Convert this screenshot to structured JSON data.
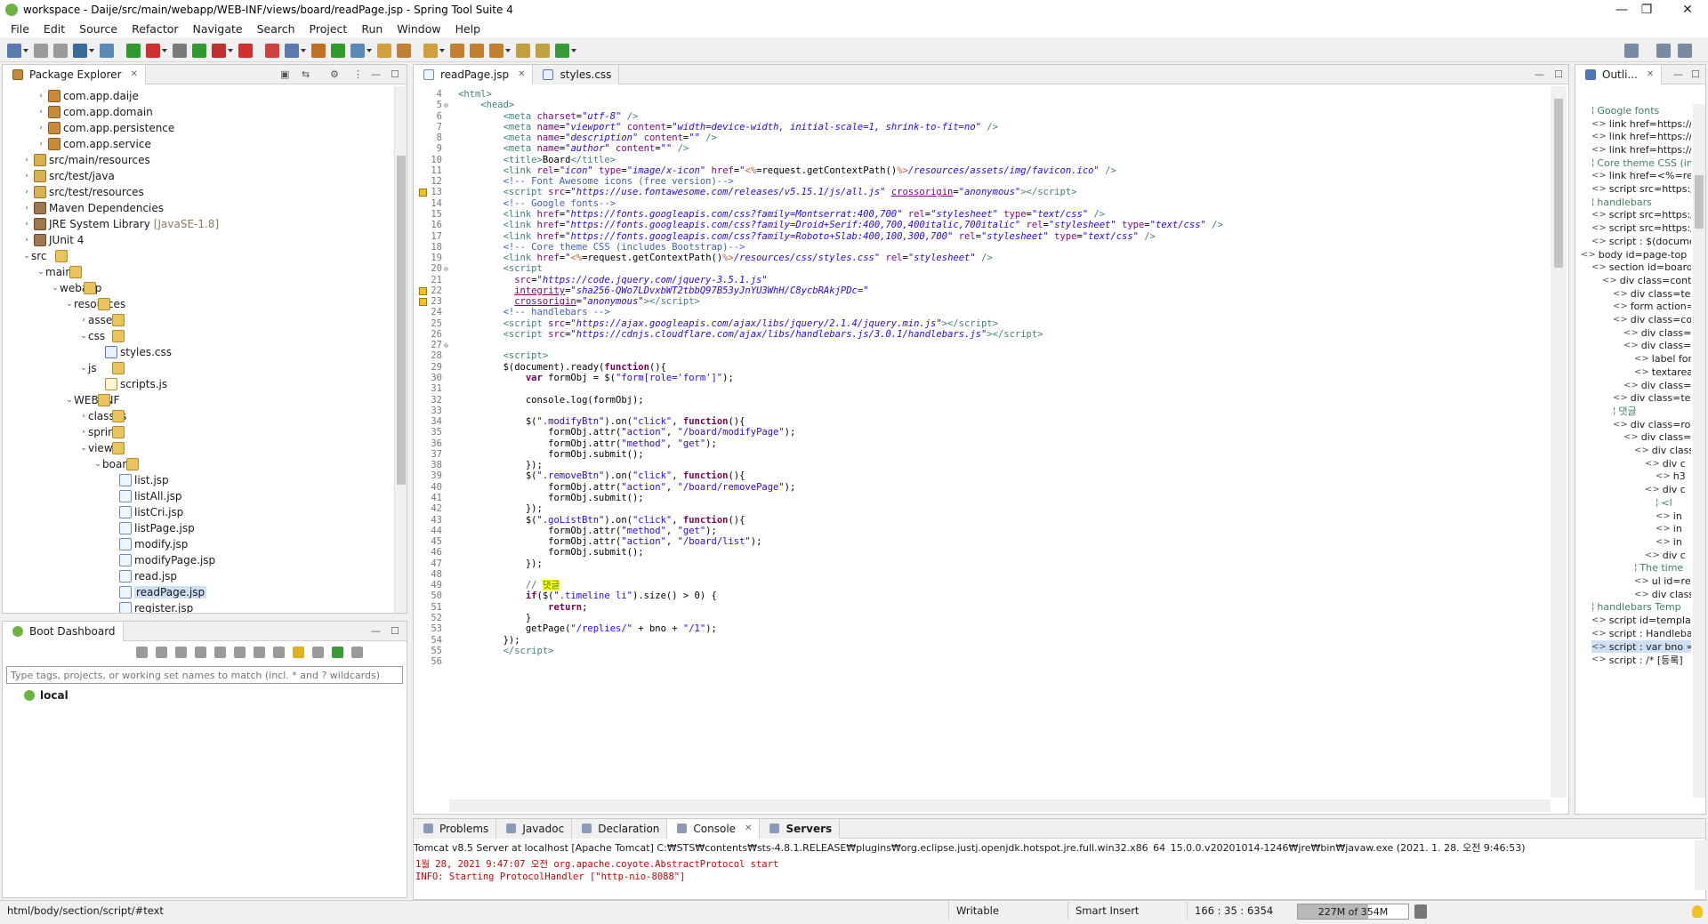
{
  "window": {
    "title": "workspace - Daije/src/main/webapp/WEB-INF/views/board/readPage.jsp - Spring Tool Suite 4",
    "controls": [
      "minimize",
      "restore",
      "close"
    ]
  },
  "menu": [
    "File",
    "Edit",
    "Source",
    "Refactor",
    "Navigate",
    "Search",
    "Project",
    "Run",
    "Window",
    "Help"
  ],
  "package_explorer": {
    "tab_label": "Package Explorer",
    "items": [
      {
        "label": "com.app.daije",
        "level": 2,
        "icon": "package-icon"
      },
      {
        "label": "com.app.domain",
        "level": 2,
        "icon": "package-icon"
      },
      {
        "label": "com.app.persistence",
        "level": 2,
        "icon": "package-icon"
      },
      {
        "label": "com.app.service",
        "level": 2,
        "icon": "package-icon"
      },
      {
        "label": "src/main/resources",
        "level": 1,
        "icon": "source-folder-icon"
      },
      {
        "label": "src/test/java",
        "level": 1,
        "icon": "source-folder-icon"
      },
      {
        "label": "src/test/resources",
        "level": 1,
        "icon": "source-folder-icon"
      },
      {
        "label": "Maven Dependencies",
        "level": 1,
        "icon": "library-icon"
      },
      {
        "label": "JRE System Library",
        "suffix": "[JavaSE-1.8]",
        "level": 1,
        "icon": "library-icon"
      },
      {
        "label": "JUnit 4",
        "level": 1,
        "icon": "library-icon"
      },
      {
        "label": "src",
        "level": 1,
        "icon": "folder-icon",
        "open": true
      },
      {
        "label": "main",
        "level": 2,
        "icon": "folder-icon",
        "open": true
      },
      {
        "label": "webapp",
        "level": 3,
        "icon": "folder-icon",
        "open": true
      },
      {
        "label": "resources",
        "level": 4,
        "icon": "folder-icon",
        "open": true
      },
      {
        "label": "assets",
        "level": 5,
        "icon": "folder-icon"
      },
      {
        "label": "css",
        "level": 5,
        "icon": "folder-icon",
        "open": true
      },
      {
        "label": "styles.css",
        "level": 6,
        "icon": "css-file-icon"
      },
      {
        "label": "js",
        "level": 5,
        "icon": "folder-icon",
        "open": true
      },
      {
        "label": "scripts.js",
        "level": 6,
        "icon": "js-file-icon"
      },
      {
        "label": "WEB-INF",
        "level": 4,
        "icon": "folder-icon",
        "open": true
      },
      {
        "label": "classes",
        "level": 5,
        "icon": "folder-icon"
      },
      {
        "label": "spring",
        "level": 5,
        "icon": "folder-icon"
      },
      {
        "label": "views",
        "level": 5,
        "icon": "folder-icon",
        "open": true
      },
      {
        "label": "board",
        "level": 6,
        "icon": "folder-icon",
        "open": true
      },
      {
        "label": "list.jsp",
        "level": 7,
        "icon": "jsp-file-icon"
      },
      {
        "label": "listAll.jsp",
        "level": 7,
        "icon": "jsp-file-icon"
      },
      {
        "label": "listCri.jsp",
        "level": 7,
        "icon": "jsp-file-icon"
      },
      {
        "label": "listPage.jsp",
        "level": 7,
        "icon": "jsp-file-icon"
      },
      {
        "label": "modify.jsp",
        "level": 7,
        "icon": "jsp-file-icon"
      },
      {
        "label": "modifyPage.jsp",
        "level": 7,
        "icon": "jsp-file-icon"
      },
      {
        "label": "read.jsp",
        "level": 7,
        "icon": "jsp-file-icon"
      },
      {
        "label": "readPage.jsp",
        "level": 7,
        "icon": "jsp-file-icon",
        "selected": true
      },
      {
        "label": "register.jsp",
        "level": 7,
        "icon": "jsp-file-icon"
      }
    ]
  },
  "boot_dashboard": {
    "tab_label": "Boot Dashboard",
    "filter_placeholder": "Type tags, projects, or working set names to match (incl. * and ? wildcards)",
    "local_label": "local"
  },
  "editor": {
    "tabs": [
      {
        "label": "readPage.jsp",
        "active": true
      },
      {
        "label": "styles.css",
        "active": false
      }
    ],
    "lines": [
      {
        "n": "4",
        "html": "<span class='tag'>&lt;html&gt;</span>"
      },
      {
        "n": "5",
        "fold": true,
        "html": "    <span class='tag'>&lt;head&gt;</span>"
      },
      {
        "n": "6",
        "html": "        <span class='tag'>&lt;meta</span> <span class='att'>charset</span>=<span class='str'>\"utf-8\"</span> <span class='tag'>/&gt;</span>"
      },
      {
        "n": "7",
        "html": "        <span class='tag'>&lt;meta</span> <span class='att'>name</span>=<span class='str'>\"viewport\"</span> <span class='att'>content</span>=<span class='str'>\"width=device-width, initial-scale=1, shrink-to-fit=no\"</span> <span class='tag'>/&gt;</span>"
      },
      {
        "n": "8",
        "html": "        <span class='tag'>&lt;meta</span> <span class='att'>name</span>=<span class='str'>\"description\"</span> <span class='att'>content</span>=<span class='str'>\"\"</span> <span class='tag'>/&gt;</span>"
      },
      {
        "n": "9",
        "html": "        <span class='tag'>&lt;meta</span> <span class='att'>name</span>=<span class='str'>\"author\"</span> <span class='att'>content</span>=<span class='str'>\"\"</span> <span class='tag'>/&gt;</span>"
      },
      {
        "n": "10",
        "html": "        <span class='tag'>&lt;title&gt;</span>Board<span class='tag'>&lt;/title&gt;</span>"
      },
      {
        "n": "11",
        "html": "        <span class='tag'>&lt;link</span> <span class='att'>rel</span>=<span class='str'>\"icon\"</span> <span class='att'>type</span>=<span class='str'>\"image/x-icon\"</span> <span class='att'>href</span>=<span class='str'>\"</span><span style='color:#bf5f3f'>&lt;%</span>=request.getContextPath()<span style='color:#bf5f3f'>%&gt;</span><span class='str'>/resources/assets/img/favicon.ico\"</span> <span class='tag'>/&gt;</span>"
      },
      {
        "n": "12",
        "html": "        <span class='cmt'>&lt;!-- Font Awesome icons (free version)--&gt;</span>"
      },
      {
        "n": "13",
        "warn": true,
        "html": "        <span class='tag'>&lt;script</span> <span class='att'>src</span>=<span class='str'>\"https://use.fontawesome.com/releases/v5.15.1/js/all.js\"</span> <span class='att' style='text-decoration:underline'>crossorigin</span>=<span class='str'>\"anonymous\"</span><span class='tag'>&gt;&lt;/script&gt;</span>"
      },
      {
        "n": "14",
        "html": "        <span class='cmt'>&lt;!-- Google fonts--&gt;</span>"
      },
      {
        "n": "15",
        "html": "        <span class='tag'>&lt;link</span> <span class='att'>href</span>=<span class='str'>\"https://fonts.googleapis.com/css?family=Montserrat:400,700\"</span> <span class='att'>rel</span>=<span class='str'>\"stylesheet\"</span> <span class='att'>type</span>=<span class='str'>\"text/css\"</span> <span class='tag'>/&gt;</span>"
      },
      {
        "n": "16",
        "html": "        <span class='tag'>&lt;link</span> <span class='att'>href</span>=<span class='str'>\"https://fonts.googleapis.com/css?family=Droid+Serif:400,700,400italic,700italic\"</span> <span class='att'>rel</span>=<span class='str'>\"stylesheet\"</span> <span class='att'>type</span>=<span class='str'>\"text/css\"</span> <span class='tag'>/&gt;</span>"
      },
      {
        "n": "17",
        "html": "        <span class='tag'>&lt;link</span> <span class='att'>href</span>=<span class='str'>\"https://fonts.googleapis.com/css?family=Roboto+Slab:400,100,300,700\"</span> <span class='att'>rel</span>=<span class='str'>\"stylesheet\"</span> <span class='att'>type</span>=<span class='str'>\"text/css\"</span> <span class='tag'>/&gt;</span>"
      },
      {
        "n": "18",
        "html": "        <span class='cmt'>&lt;!-- Core theme CSS (includes Bootstrap)--&gt;</span>"
      },
      {
        "n": "19",
        "html": "        <span class='tag'>&lt;link</span> <span class='att'>href</span>=<span class='str'>\"</span><span style='color:#bf5f3f'>&lt;%</span>=request.getContextPath()<span style='color:#bf5f3f'>%&gt;</span><span class='str'>/resources/css/styles.css\"</span> <span class='att'>rel</span>=<span class='str'>\"stylesheet\"</span> <span class='tag'>/&gt;</span>"
      },
      {
        "n": "20",
        "fold": true,
        "html": "        <span class='tag'>&lt;script</span>"
      },
      {
        "n": "21",
        "html": "          <span class='att'>src</span>=<span class='str'>\"https://code.jquery.com/jquery-3.5.1.js\"</span>"
      },
      {
        "n": "22",
        "warn": true,
        "html": "          <span class='att' style='text-decoration:underline'>integrity</span>=<span class='str'>\"sha256-QWo7LDvxbWT2tbbQ97B53yJnYU3WhH/C8ycbRAkjPDc=\"</span>"
      },
      {
        "n": "23",
        "warn": true,
        "html": "          <span class='att' style='text-decoration:underline'>crossorigin</span>=<span class='str'>\"anonymous\"</span><span class='tag'>&gt;&lt;/script&gt;</span>"
      },
      {
        "n": "24",
        "html": "        <span class='cmt'>&lt;!-- handlebars --&gt;</span>"
      },
      {
        "n": "25",
        "html": "        <span class='tag'>&lt;script</span> <span class='att'>src</span>=<span class='str'>\"https://ajax.googleapis.com/ajax/libs/jquery/2.1.4/jquery.min.js\"</span><span class='tag'>&gt;&lt;/script&gt;</span>"
      },
      {
        "n": "26",
        "html": "        <span class='tag'>&lt;script</span> <span class='att'>src</span>=<span class='str'>\"https://cdnjs.cloudflare.com/ajax/libs/handlebars.js/3.0.1/handlebars.js\"</span><span class='tag'>&gt;&lt;/script&gt;</span>"
      },
      {
        "n": "27",
        "fold": true,
        "html": ""
      },
      {
        "n": "28",
        "html": "        <span class='tag'>&lt;script&gt;</span>"
      },
      {
        "n": "29",
        "html": "        $(document).ready(<span class='kw'>function</span>(){"
      },
      {
        "n": "30",
        "html": "            <span class='kw'>var</span> formObj = $(<span class='jstr'>\"form[role='form']\"</span>);"
      },
      {
        "n": "31",
        "html": ""
      },
      {
        "n": "32",
        "html": "            console.log(formObj);"
      },
      {
        "n": "33",
        "html": ""
      },
      {
        "n": "34",
        "html": "            $(<span class='jstr'>\".modifyBtn\"</span>).on(<span class='jstr'>\"click\"</span>, <span class='kw'>function</span>(){"
      },
      {
        "n": "35",
        "html": "                formObj.attr(<span class='jstr'>\"action\"</span>, <span class='jstr'>\"/board/modifyPage\"</span>);"
      },
      {
        "n": "36",
        "html": "                formObj.attr(<span class='jstr'>\"method\"</span>, <span class='jstr'>\"get\"</span>);"
      },
      {
        "n": "37",
        "html": "                formObj.submit();"
      },
      {
        "n": "38",
        "html": "            });"
      },
      {
        "n": "39",
        "html": "            $(<span class='jstr'>\".removeBtn\"</span>).on(<span class='jstr'>\"click\"</span>, <span class='kw'>function</span>(){"
      },
      {
        "n": "40",
        "html": "                formObj.attr(<span class='jstr'>\"action\"</span>, <span class='jstr'>\"/board/removePage\"</span>);"
      },
      {
        "n": "41",
        "html": "                formObj.submit();"
      },
      {
        "n": "42",
        "html": "            });"
      },
      {
        "n": "43",
        "html": "            $(<span class='jstr'>\".goListBtn\"</span>).on(<span class='jstr'>\"click\"</span>, <span class='kw'>function</span>(){"
      },
      {
        "n": "44",
        "html": "                formObj.attr(<span class='jstr'>\"method\"</span>, <span class='jstr'>\"get\"</span>);"
      },
      {
        "n": "45",
        "html": "                formObj.attr(<span class='jstr'>\"action\"</span>, <span class='jstr'>\"/board/list\"</span>);"
      },
      {
        "n": "46",
        "html": "                formObj.submit();"
      },
      {
        "n": "47",
        "html": "            });"
      },
      {
        "n": "48",
        "html": ""
      },
      {
        "n": "49",
        "html": "            <span style='color:#3f7f5f'>// </span><span style='background:#ffff00;color:#3f7f5f'>댓글</span>"
      },
      {
        "n": "50",
        "html": "            <span class='kw'>if</span>($(<span class='jstr'>\".timeline li\"</span>).size() &gt; 0) {"
      },
      {
        "n": "51",
        "html": "                <span class='kw'>return</span>;"
      },
      {
        "n": "52",
        "html": "            }"
      },
      {
        "n": "53",
        "html": "            getPage(<span class='jstr'>\"/replies/\"</span> + bno + <span class='jstr'>\"/1\"</span>);"
      },
      {
        "n": "54",
        "html": "        });"
      },
      {
        "n": "55",
        "html": "        <span class='tag'>&lt;/script&gt;</span>"
      },
      {
        "n": "56",
        "html": ""
      }
    ]
  },
  "outline": {
    "tab_label": "Outli...",
    "items": [
      {
        "text": "Google fonts",
        "indent": 0,
        "icon": "comment-icon",
        "color": "#3f7f5f"
      },
      {
        "text": "link href=https://for",
        "indent": 0,
        "icon": "tag-icon"
      },
      {
        "text": "link href=https://for",
        "indent": 0,
        "icon": "tag-icon"
      },
      {
        "text": "link href=https://for",
        "indent": 0,
        "icon": "tag-icon"
      },
      {
        "text": "Core theme CSS (in",
        "indent": 0,
        "icon": "comment-icon",
        "color": "#3f7f5f"
      },
      {
        "text": "link href=<%=reque",
        "indent": 0,
        "icon": "tag-icon"
      },
      {
        "text": "script src=https://cc",
        "indent": 0,
        "icon": "tag-icon"
      },
      {
        "text": "handlebars",
        "indent": 0,
        "icon": "comment-icon",
        "color": "#3f7f5f"
      },
      {
        "text": "script src=https://aj",
        "indent": 0,
        "icon": "tag-icon"
      },
      {
        "text": "script src=https://cc",
        "indent": 0,
        "icon": "tag-icon"
      },
      {
        "text": "script : $(document",
        "indent": 0,
        "icon": "tag-icon"
      },
      {
        "text": "body id=page-top",
        "indent": -1,
        "icon": "tag-icon"
      },
      {
        "text": "section id=board",
        "indent": 0,
        "icon": "tag-icon"
      },
      {
        "text": "div class=contair",
        "indent": 1,
        "icon": "tag-icon"
      },
      {
        "text": "div class=text-",
        "indent": 2,
        "icon": "tag-icon"
      },
      {
        "text": "form action=r",
        "indent": 2,
        "icon": "tag-icon"
      },
      {
        "text": "div class=col-",
        "indent": 2,
        "icon": "tag-icon"
      },
      {
        "text": "div class=fo",
        "indent": 3,
        "icon": "tag-icon"
      },
      {
        "text": "div class=fo",
        "indent": 3,
        "icon": "tag-icon"
      },
      {
        "text": "label for",
        "indent": 4,
        "icon": "tag-icon"
      },
      {
        "text": "textarea",
        "indent": 4,
        "icon": "tag-icon"
      },
      {
        "text": "div class=fo",
        "indent": 3,
        "icon": "tag-icon"
      },
      {
        "text": "div class=text-",
        "indent": 2,
        "icon": "tag-icon"
      },
      {
        "text": "댓글",
        "indent": 2,
        "icon": "comment-icon",
        "color": "#3f7f5f"
      },
      {
        "text": "div class=row",
        "indent": 2,
        "icon": "tag-icon"
      },
      {
        "text": "div class=c",
        "indent": 3,
        "icon": "tag-icon"
      },
      {
        "text": "div class",
        "indent": 4,
        "icon": "tag-icon"
      },
      {
        "text": "div c",
        "indent": 5,
        "icon": "tag-icon"
      },
      {
        "text": "h3",
        "indent": 6,
        "icon": "tag-icon"
      },
      {
        "text": "div c",
        "indent": 5,
        "icon": "tag-icon"
      },
      {
        "text": "<l",
        "indent": 6,
        "icon": "comment-icon",
        "color": "#3f7f5f"
      },
      {
        "text": "in",
        "indent": 6,
        "icon": "tag-icon"
      },
      {
        "text": "in",
        "indent": 6,
        "icon": "tag-icon"
      },
      {
        "text": "in",
        "indent": 6,
        "icon": "tag-icon"
      },
      {
        "text": "div c",
        "indent": 5,
        "icon": "tag-icon"
      },
      {
        "text": "The time",
        "indent": 4,
        "icon": "comment-icon",
        "color": "#3f7f5f"
      },
      {
        "text": "ul id=re",
        "indent": 4,
        "icon": "tag-icon"
      },
      {
        "text": "div class",
        "indent": 4,
        "icon": "tag-icon"
      },
      {
        "text": "handlebars Temp",
        "indent": 0,
        "icon": "comment-icon",
        "color": "#3f7f5f"
      },
      {
        "text": "script id=templat",
        "indent": 0,
        "icon": "tag-icon"
      },
      {
        "text": "script : Handleba",
        "indent": 0,
        "icon": "tag-icon"
      },
      {
        "text": "script : var bno =",
        "indent": 0,
        "icon": "tag-icon",
        "selected": true
      },
      {
        "text": "script : /* [등록]",
        "indent": 0,
        "icon": "tag-icon"
      }
    ]
  },
  "bottom": {
    "tabs": [
      {
        "label": "Problems",
        "icon": "problems-icon"
      },
      {
        "label": "Javadoc",
        "icon": "javadoc-icon"
      },
      {
        "label": "Declaration",
        "icon": "declaration-icon"
      },
      {
        "label": "Console",
        "icon": "console-icon",
        "closable": true
      },
      {
        "label": "Servers",
        "icon": "servers-icon",
        "bold": true
      }
    ],
    "console_header": "Tomcat v8.5 Server at localhost [Apache Tomcat] C:₩STS₩contents₩sts-4.8.1.RELEASE₩plugins₩org.eclipse.justj.openjdk.hotspot.jre.full.win32.x86_64_15.0.0.v20201014-1246₩jre₩bin₩javaw.exe  (2021. 1. 28. 오전 9:46:53)",
    "console_lines": [
      "1월 28, 2021 9:47:07 오전 org.apache.coyote.AbstractProtocol start",
      "INFO: Starting ProtocolHandler [\"http-nio-8088\"]"
    ]
  },
  "statusbar": {
    "path": "html/body/section/script/#text",
    "writable": "Writable",
    "insert_mode": "Smart Insert",
    "position": "166 : 35 : 6354",
    "memory": "227M of 354M",
    "memory_used_fraction": 0.64
  }
}
